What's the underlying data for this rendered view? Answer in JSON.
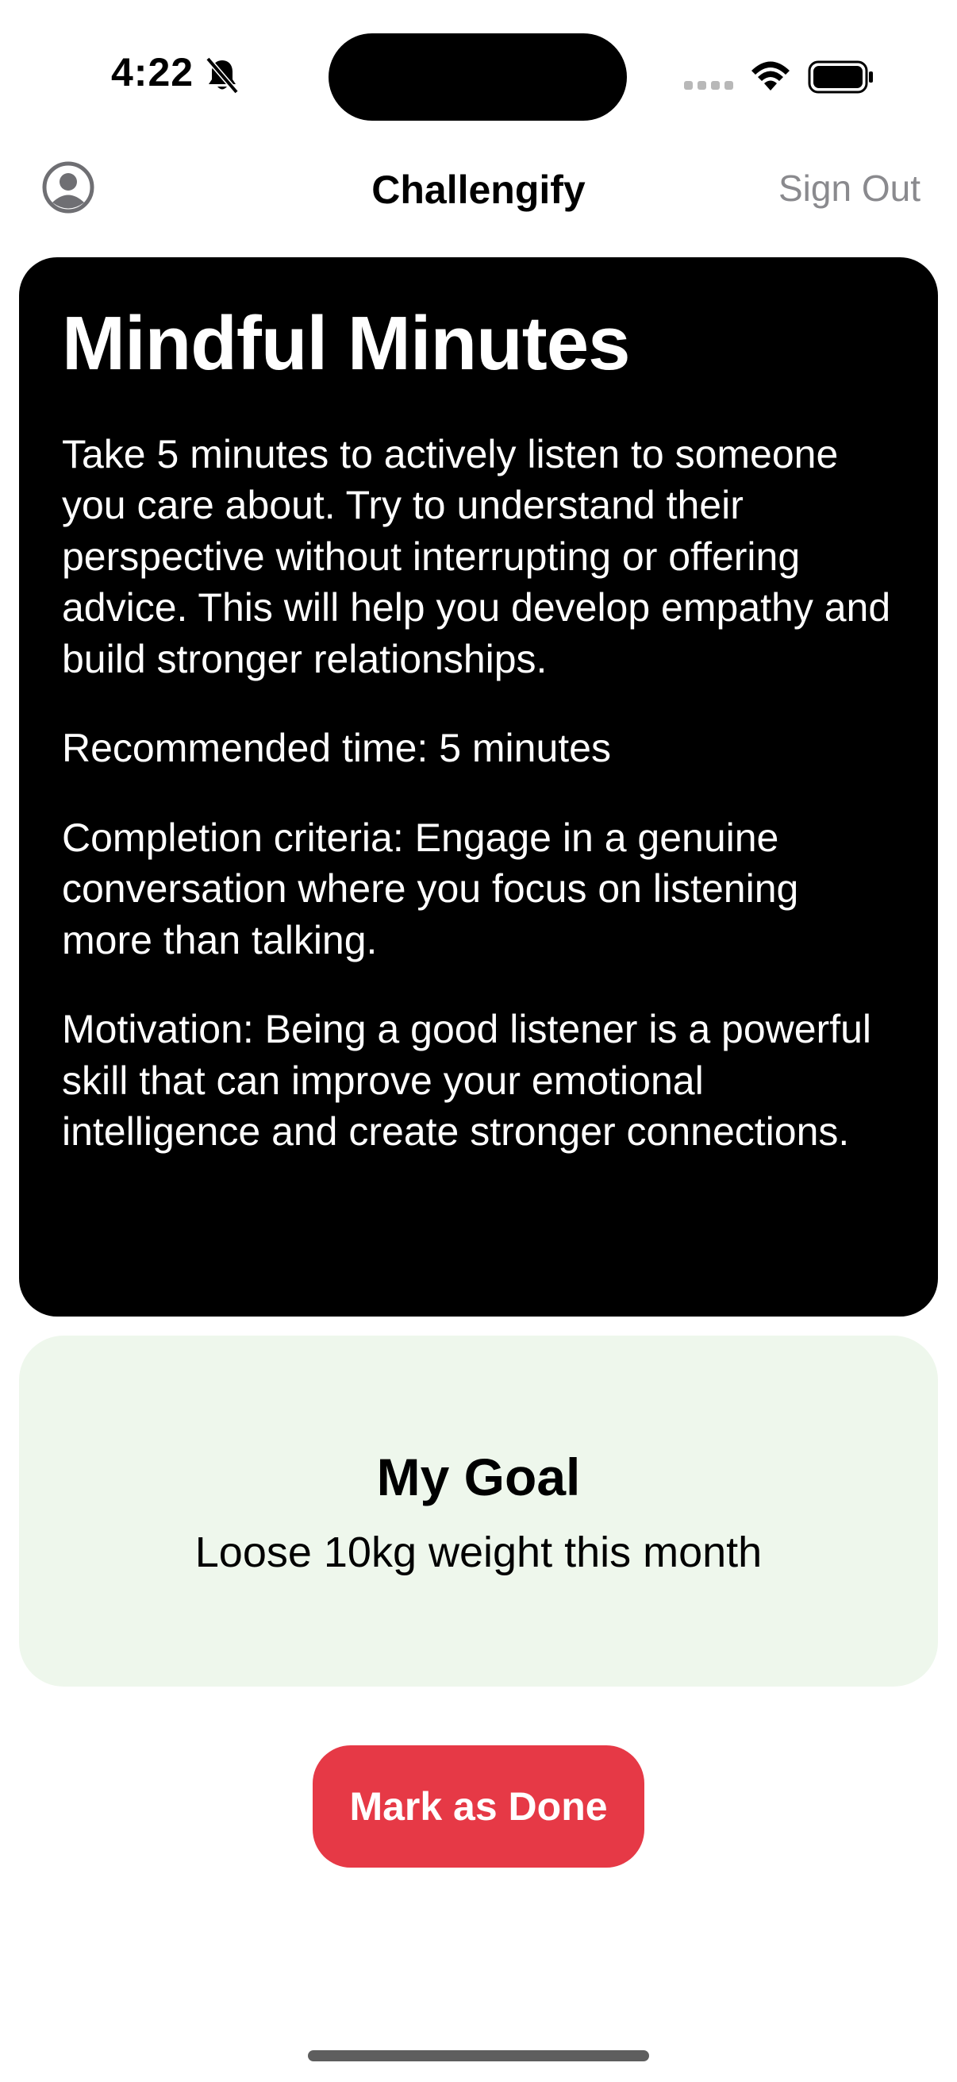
{
  "status_bar": {
    "time": "4:22",
    "icons": [
      "bell-slash-icon",
      "signal-icon",
      "wifi-icon",
      "battery-icon"
    ]
  },
  "nav": {
    "profile_icon": "person-circle-icon",
    "title": "Challengify",
    "sign_out_label": "Sign Out"
  },
  "challenge": {
    "title": "Mindful Minutes",
    "description": "Take 5 minutes to actively listen to someone you care about. Try to understand their perspective without interrupting or offering advice.  This will help you develop empathy and build stronger relationships.",
    "recommended_time": "Recommended time: 5 minutes",
    "completion_criteria": "Completion criteria:  Engage in a genuine conversation where you focus on listening more than talking.",
    "motivation": "Motivation:  Being a good listener is a powerful skill that can improve your emotional intelligence and create stronger connections."
  },
  "goal": {
    "title": "My Goal",
    "text": "Loose 10kg weight this month"
  },
  "actions": {
    "done_label": "Mark as Done"
  },
  "colors": {
    "card_background": "#000000",
    "goal_background": "#eef7ec",
    "button_red": "#e63946",
    "muted_gray": "#8a8a8e"
  }
}
